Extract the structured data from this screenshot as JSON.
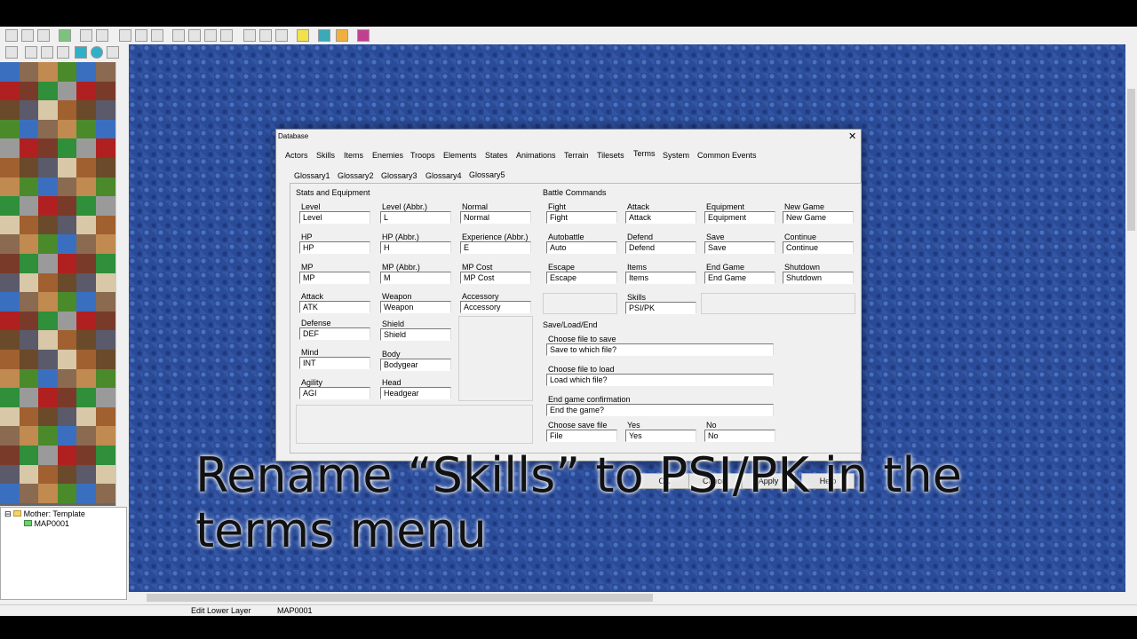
{
  "dialog": {
    "title": "Database",
    "close_glyph": "✕",
    "tabs": [
      "Actors",
      "Skills",
      "Items",
      "Enemies",
      "Troops",
      "Elements",
      "States",
      "Animations",
      "Terrain",
      "Tilesets",
      "Terms",
      "System",
      "Common Events"
    ],
    "subtabs": [
      "Glossary1",
      "Glossary2",
      "Glossary3",
      "Glossary4",
      "Glossary5"
    ],
    "stats_title": "Stats and Equipment",
    "battle_title": "Battle Commands",
    "save_title": "Save/Load/End",
    "stats": [
      {
        "label": "Level",
        "value": "Level"
      },
      {
        "label": "Level (Abbr.)",
        "value": "L"
      },
      {
        "label": "Normal",
        "value": "Normal"
      },
      {
        "label": "HP",
        "value": "HP"
      },
      {
        "label": "HP (Abbr.)",
        "value": "H"
      },
      {
        "label": "Experience (Abbr.)",
        "value": "E"
      },
      {
        "label": "MP",
        "value": "MP"
      },
      {
        "label": "MP (Abbr.)",
        "value": "M"
      },
      {
        "label": "MP Cost",
        "value": "MP Cost"
      },
      {
        "label": "Attack",
        "value": "ATK"
      },
      {
        "label": "Weapon",
        "value": "Weapon"
      },
      {
        "label": "Accessory",
        "value": "Accessory"
      },
      {
        "label": "Defense",
        "value": "DEF"
      },
      {
        "label": "Shield",
        "value": "Shield"
      },
      {
        "label": "Mind",
        "value": "INT"
      },
      {
        "label": "Body",
        "value": "Bodygear"
      },
      {
        "label": "Agility",
        "value": "AGI"
      },
      {
        "label": "Head",
        "value": "Headgear"
      }
    ],
    "battle": [
      {
        "label": "Fight",
        "value": "Fight"
      },
      {
        "label": "Attack",
        "value": "Attack"
      },
      {
        "label": "Equipment",
        "value": "Equipment"
      },
      {
        "label": "New Game",
        "value": "New Game"
      },
      {
        "label": "Autobattle",
        "value": "Auto"
      },
      {
        "label": "Defend",
        "value": "Defend"
      },
      {
        "label": "Save",
        "value": "Save"
      },
      {
        "label": "Continue",
        "value": "Continue"
      },
      {
        "label": "Escape",
        "value": "Escape"
      },
      {
        "label": "Items",
        "value": "Items"
      },
      {
        "label": "End Game",
        "value": "End Game"
      },
      {
        "label": "Shutdown",
        "value": "Shutdown"
      },
      {
        "label": "Skills",
        "value": "PSI/PK"
      }
    ],
    "save": [
      {
        "label": "Choose file to save",
        "value": "Save to which file?"
      },
      {
        "label": "Choose file to load",
        "value": "Load which file?"
      },
      {
        "label": "End game confirmation",
        "value": "End the game?"
      }
    ],
    "confirm": [
      {
        "label": "Choose save file",
        "value": "File"
      },
      {
        "label": "Yes",
        "value": "Yes"
      },
      {
        "label": "No",
        "value": "No"
      }
    ],
    "buttons": [
      "OK",
      "Cancel",
      "Apply",
      "Help"
    ]
  },
  "tree": {
    "root": "Mother: Template",
    "child": "MAP0001"
  },
  "status": {
    "mode": "Edit Lower Layer",
    "map": "MAP0001"
  },
  "caption": "Rename “Skills” to PSI/PK in the terms menu",
  "colors": {
    "map_bg": "#2a4b98",
    "dialog_bg": "#f0f0f0"
  }
}
